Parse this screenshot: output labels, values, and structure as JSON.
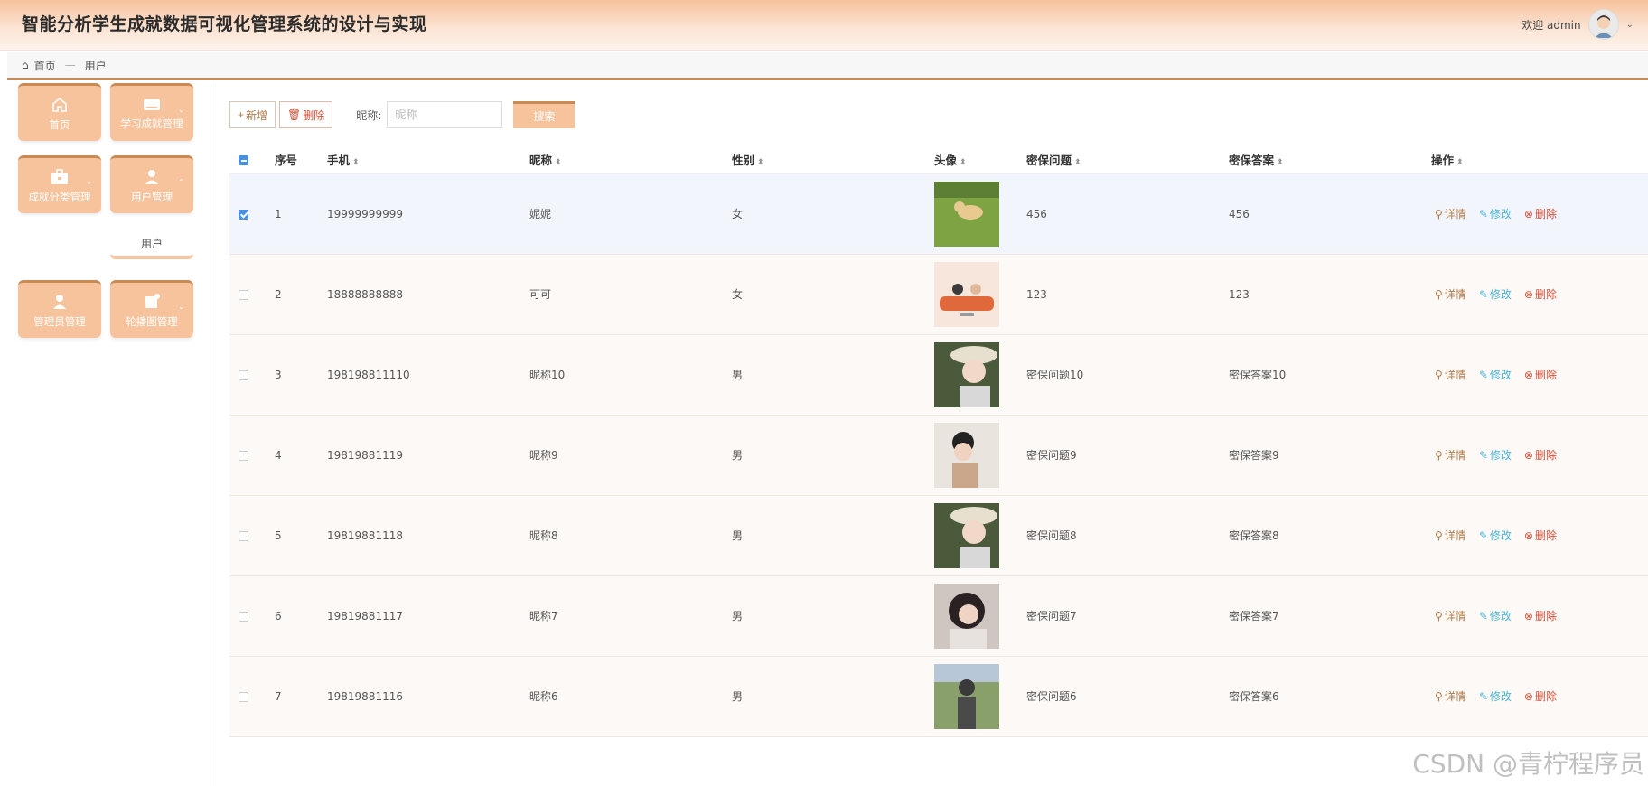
{
  "header": {
    "title": "智能分析学生成就数据可视化管理系统的设计与实现",
    "welcome": "欢迎 admin"
  },
  "breadcrumb": {
    "home": "首页",
    "separator": "—",
    "current": "用户"
  },
  "sidebar": {
    "tiles": [
      {
        "label": "首页",
        "icon": "home-icon"
      },
      {
        "label": "学习成就管理",
        "icon": "ticket-icon"
      },
      {
        "label": "成就分类管理",
        "icon": "briefcase-icon"
      },
      {
        "label": "用户管理",
        "icon": "user-icon"
      },
      {
        "label": "管理员管理",
        "icon": "admin-icon"
      },
      {
        "label": "轮播图管理",
        "icon": "carousel-icon"
      }
    ],
    "submenu": {
      "label": "用户"
    }
  },
  "toolbar": {
    "add_label": "新增",
    "delete_label": "删除",
    "search_label": "昵称:",
    "search_placeholder": "昵称",
    "search_button": "搜索"
  },
  "table": {
    "headers": [
      "序号",
      "手机",
      "昵称",
      "性别",
      "头像",
      "密保问题",
      "密保答案",
      "操作"
    ],
    "rows": [
      {
        "index": "1",
        "phone": "19999999999",
        "nickname": "妮妮",
        "gender": "女",
        "question": "456",
        "answer": "456",
        "selected": true
      },
      {
        "index": "2",
        "phone": "18888888888",
        "nickname": "可可",
        "gender": "女",
        "question": "123",
        "answer": "123",
        "selected": false
      },
      {
        "index": "3",
        "phone": "198198811110",
        "nickname": "昵称10",
        "gender": "男",
        "question": "密保问题10",
        "answer": "密保答案10",
        "selected": false
      },
      {
        "index": "4",
        "phone": "19819881119",
        "nickname": "昵称9",
        "gender": "男",
        "question": "密保问题9",
        "answer": "密保答案9",
        "selected": false
      },
      {
        "index": "5",
        "phone": "19819881118",
        "nickname": "昵称8",
        "gender": "男",
        "question": "密保问题8",
        "answer": "密保答案8",
        "selected": false
      },
      {
        "index": "6",
        "phone": "19819881117",
        "nickname": "昵称7",
        "gender": "男",
        "question": "密保问题7",
        "answer": "密保答案7",
        "selected": false
      },
      {
        "index": "7",
        "phone": "19819881116",
        "nickname": "昵称6",
        "gender": "男",
        "question": "密保问题6",
        "answer": "密保答案6",
        "selected": false
      }
    ],
    "actions": {
      "detail": "详情",
      "edit": "修改",
      "delete": "删除"
    }
  },
  "watermark": "CSDN @青柠程序员",
  "colors": {
    "accent": "#f6c39c",
    "accent_dark": "#c98b55",
    "edit": "#4ab5d5",
    "delete": "#d2513a",
    "checkbox": "#4a90e2"
  }
}
